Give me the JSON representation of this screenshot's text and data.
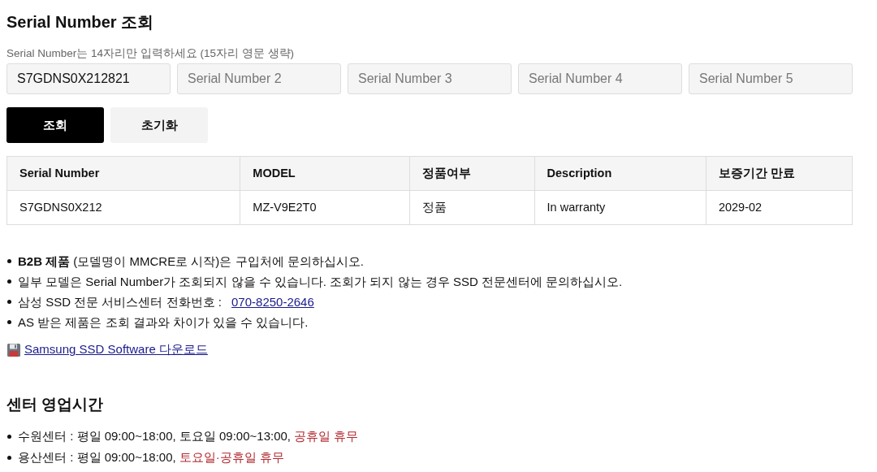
{
  "title": "Serial Number 조회",
  "hint": "Serial Number는 14자리만 입력하세요 (15자리 영문 생략)",
  "fields": [
    {
      "value": "S7GDNS0X212821"
    },
    {
      "placeholder": "Serial Number 2"
    },
    {
      "placeholder": "Serial Number 3"
    },
    {
      "placeholder": "Serial Number 4"
    },
    {
      "placeholder": "Serial Number 5"
    }
  ],
  "buttons": [
    {
      "label": "조회",
      "kind": "primary"
    },
    {
      "label": "초기화",
      "kind": "secondary"
    }
  ],
  "table": {
    "columns": [
      "Serial Number",
      "MODEL",
      "정품여부",
      "Description",
      "보증기간 만료"
    ],
    "rows": [
      [
        "S7GDNS0X212",
        "MZ-V9E2T0",
        "정품",
        "In warranty",
        "2029-02"
      ]
    ]
  },
  "notes": [
    {
      "text": "**B2B 제품** (모델명이 MMCRE로 시작)은 구입처에 문의하십시오."
    },
    {
      "text": "일부 모델은 Serial Number가 조회되지 않을 수 있습니다. 조회가 되지 않는 경우 SSD 전문센터에 문의하십시오."
    },
    {
      "text": "삼성 SSD 전문 서비스센터 전화번호 : ",
      "link": "070-8250-2646"
    },
    {
      "text": "AS 받은 제품은 조회 결과와 차이가 있을 수 있습니다."
    }
  ],
  "download_link": "Samsung SSD Software 다운로드",
  "hours_title": "센터 영업시간",
  "hours": [
    {
      "text": "수원센터 : 평일 09:00~18:00, 토요일 09:00~13:00, ",
      "closed": "공휴일 휴무"
    },
    {
      "text": "용산센터 : 평일 09:00~18:00, ",
      "closed": "토요일·공휴일 휴무"
    }
  ]
}
